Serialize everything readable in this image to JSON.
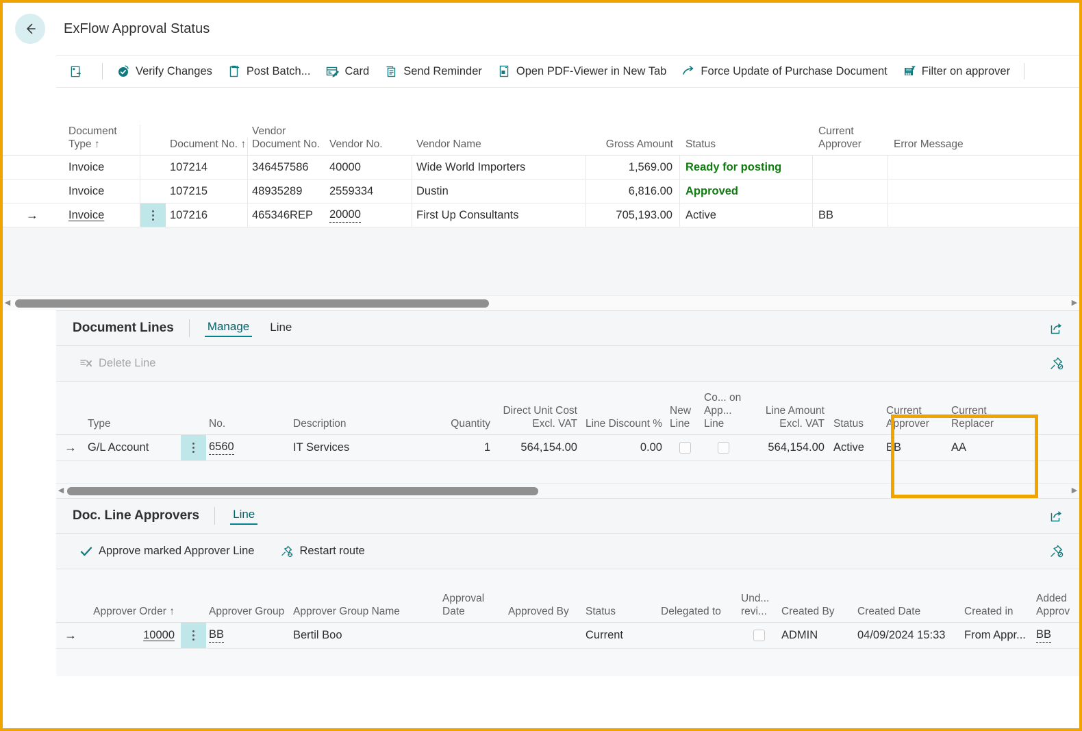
{
  "window": {
    "title": "ExFlow Approval Status",
    "back_icon": "back-arrow-icon",
    "accent": "#127b80",
    "highlight_color": "#f0a400"
  },
  "ribbon": {
    "items": [
      {
        "label": "",
        "icon": "open-in-new-window-icon"
      },
      {
        "label": "Verify Changes",
        "icon": "verify-icon"
      },
      {
        "label": "Post Batch...",
        "icon": "post-batch-icon"
      },
      {
        "label": "Card",
        "icon": "card-icon"
      },
      {
        "label": "Send Reminder",
        "icon": "send-reminder-icon"
      },
      {
        "label": "Open PDF-Viewer in New Tab",
        "icon": "pdf-viewer-icon"
      },
      {
        "label": "Force Update of Purchase Document",
        "icon": "force-update-icon"
      },
      {
        "label": "Filter on approver",
        "icon": "filter-icon"
      }
    ]
  },
  "main_grid": {
    "columns": [
      {
        "key": "doc_type",
        "label": "Document Type ↑"
      },
      {
        "key": "doc_no",
        "label": "Document No. ↑"
      },
      {
        "key": "vendor_doc_no",
        "label": "Vendor Document No."
      },
      {
        "key": "vendor_no",
        "label": "Vendor No."
      },
      {
        "key": "vendor_name",
        "label": "Vendor Name"
      },
      {
        "key": "gross_amount",
        "label": "Gross Amount"
      },
      {
        "key": "status",
        "label": "Status"
      },
      {
        "key": "current_approver",
        "label": "Current Approver"
      },
      {
        "key": "error_message",
        "label": "Error Message"
      }
    ],
    "rows": [
      {
        "selected": false,
        "doc_type": "Invoice",
        "doc_no": "107214",
        "vendor_doc_no": "346457586",
        "vendor_no": "40000",
        "vendor_name": "Wide World Importers",
        "gross_amount": "1,569.00",
        "status": "Ready for posting",
        "status_style": "ok",
        "current_approver": "",
        "error_message": ""
      },
      {
        "selected": false,
        "doc_type": "Invoice",
        "doc_no": "107215",
        "vendor_doc_no": "48935289",
        "vendor_no": "2559334",
        "vendor_name": "Dustin",
        "gross_amount": "6,816.00",
        "status": "Approved",
        "status_style": "ok",
        "current_approver": "",
        "error_message": ""
      },
      {
        "selected": true,
        "doc_type": "Invoice",
        "doc_no": "107216",
        "vendor_doc_no": "465346REP",
        "vendor_no": "20000",
        "vendor_name": "First Up Consultants",
        "gross_amount": "705,193.00",
        "status": "Active",
        "status_style": "normal",
        "current_approver": "BB",
        "error_message": ""
      }
    ]
  },
  "document_lines": {
    "title": "Document Lines",
    "tabs": [
      {
        "label": "Manage",
        "active": true
      },
      {
        "label": "Line",
        "active": false
      }
    ],
    "header_icon": "share-export-icon",
    "toolbar": {
      "delete_line": "Delete Line",
      "delete_line_icon": "delete-line-icon",
      "pin_icon": "unpin-icon"
    },
    "columns": [
      {
        "key": "type",
        "label": "Type"
      },
      {
        "key": "no",
        "label": "No."
      },
      {
        "key": "description",
        "label": "Description"
      },
      {
        "key": "quantity",
        "label": "Quantity"
      },
      {
        "key": "direct_unit_cost",
        "label": "Direct Unit Cost Excl. VAT"
      },
      {
        "key": "line_discount",
        "label": "Line Discount %"
      },
      {
        "key": "new_line",
        "label": "New Line"
      },
      {
        "key": "comment_on_app_line",
        "label": "Co... on App... Line"
      },
      {
        "key": "line_amount",
        "label": "Line Amount Excl. VAT"
      },
      {
        "key": "status",
        "label": "Status"
      },
      {
        "key": "current_approver",
        "label": "Current Approver"
      },
      {
        "key": "current_replacer",
        "label": "Current Replacer"
      }
    ],
    "rows": [
      {
        "selected": true,
        "type": "G/L Account",
        "no": "6560",
        "description": "IT Services",
        "quantity": "1",
        "direct_unit_cost": "564,154.00",
        "line_discount": "0.00",
        "new_line_checked": false,
        "comment_checked": false,
        "line_amount": "564,154.00",
        "status": "Active",
        "current_approver": "BB",
        "current_replacer": "AA"
      }
    ]
  },
  "doc_line_approvers": {
    "title": "Doc. Line Approvers",
    "tabs": [
      {
        "label": "Line",
        "active": true
      }
    ],
    "header_icon": "share-export-icon",
    "toolbar": {
      "approve_marked": "Approve marked Approver Line",
      "approve_icon": "checkmark-icon",
      "restart_route": "Restart route",
      "restart_icon": "restart-route-icon",
      "pin_icon": "unpin-icon"
    },
    "columns": [
      {
        "key": "approver_order",
        "label": "Approver Order ↑"
      },
      {
        "key": "approver_group",
        "label": "Approver Group"
      },
      {
        "key": "approver_group_name",
        "label": "Approver Group Name"
      },
      {
        "key": "approval_date",
        "label": "Approval Date"
      },
      {
        "key": "approved_by",
        "label": "Approved By"
      },
      {
        "key": "status",
        "label": "Status"
      },
      {
        "key": "delegated_to",
        "label": "Delegated to"
      },
      {
        "key": "under_revision",
        "label": "Und... revi..."
      },
      {
        "key": "created_by",
        "label": "Created By"
      },
      {
        "key": "created_date",
        "label": "Created Date"
      },
      {
        "key": "created_in",
        "label": "Created in"
      },
      {
        "key": "added_approver",
        "label": "Added Approv"
      }
    ],
    "rows": [
      {
        "selected": true,
        "approver_order": "10000",
        "approver_group": "BB",
        "approver_group_name": "Bertil Boo",
        "approval_date": "",
        "approved_by": "",
        "status": "Current",
        "delegated_to": "",
        "under_revision_checked": false,
        "created_by": "ADMIN",
        "created_date": "04/09/2024 15:33",
        "created_in": "From Appr...",
        "added_approver": "BB"
      }
    ]
  }
}
